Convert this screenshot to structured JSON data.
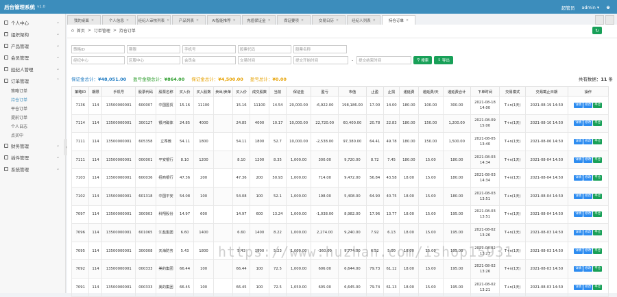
{
  "app": {
    "title": "后台管理系统",
    "version": "v1.0",
    "user_label": "超管员",
    "admin": "admin"
  },
  "sidebar": {
    "items": [
      {
        "label": "个人中心"
      },
      {
        "label": "组织架构"
      },
      {
        "label": "产品管理"
      },
      {
        "label": "会员管理"
      },
      {
        "label": "经纪人管理"
      },
      {
        "label": "订单管理"
      }
    ],
    "sub": [
      "策略订单",
      "持仓订单",
      "平仓订单",
      "提前订单",
      "个人日志",
      "点买中"
    ],
    "bottom": [
      {
        "label": "财务管理"
      },
      {
        "label": "插件管理"
      },
      {
        "label": "系统管理"
      }
    ]
  },
  "tabs": [
    "我的桌面",
    "个人信息",
    "经纪人审核列表",
    "产品列表",
    "AI智能推荐",
    "充值保证金",
    "保证要项",
    "交易日历",
    "经纪人列表",
    "持仓订单"
  ],
  "breadcrumb": {
    "home": "首页",
    "sep": ">",
    "level1": "订单管理",
    "level2": "持仓订单"
  },
  "filters": {
    "row1": [
      "策略ID",
      "期限",
      "手机号",
      "股票代码",
      "股票名称"
    ],
    "row2": [
      "经纪中心",
      "区服中心",
      "会员会",
      "交易时间",
      "提交开始时间",
      "-",
      "提交结束时间"
    ],
    "search_btn": "搜索",
    "export_btn": "导出"
  },
  "stats": {
    "s1_label": "保证金总计：",
    "s1_value": "¥48,051.00",
    "s2_label": "盈亏金额总计：",
    "s2_value": "¥864.00",
    "s3_label": "保证金总计：",
    "s3_value": "¥4,500.00",
    "s4_label": "盈亏总计：",
    "s4_value": "¥0.00",
    "total_label": "共有数据：",
    "total_value": "11",
    "total_unit": "条"
  },
  "table": {
    "headers": [
      "策略ID",
      "期限",
      "手机号",
      "股票代码",
      "股票名称",
      "买入价",
      "买入股数",
      "卖出/卖单",
      "买入价",
      "成交股数",
      "当前",
      "保证金",
      "盈亏",
      "市值",
      "止盈",
      "止损",
      "递延费",
      "递延费/天",
      "递延费合计",
      "下单时间",
      "交易模式",
      "交易截止日期",
      "操作"
    ],
    "rows": [
      [
        "7136",
        "114",
        "13500000001",
        "600007",
        "中国国贸",
        "15.16",
        "11100",
        "",
        "15.16",
        "11100",
        "14.54",
        "20,000.00",
        "-6,922.00",
        "198,186.00",
        "17.00",
        "14.00",
        "180.00",
        "100.00",
        "300.00",
        "2021-08-18 14:00",
        "T+n(1天)",
        "2021-08-19 14:50"
      ],
      [
        "7114",
        "114",
        "13500000001",
        "300127",
        "银河磁体",
        "24.85",
        "4000",
        "",
        "24.85",
        "4000",
        "10.17",
        "10,000.00",
        "22,720.00",
        "60,400.00",
        "20.78",
        "22.83",
        "180.00",
        "150.00",
        "1,200.00",
        "2021-08-09 15:00",
        "T+n(1天)",
        "2021-08-10 14:50"
      ],
      [
        "7111",
        "114",
        "13500000001",
        "605358",
        "立昂微",
        "54.11",
        "1800",
        "",
        "54.11",
        "1800",
        "52.7",
        "10,000.00",
        "-2,538.00",
        "97,380.00",
        "64.41",
        "49.78",
        "180.00",
        "150.00",
        "1,500.00",
        "2021-08-05 13:40",
        "T+n(1天)",
        "2021-08-06 14:50"
      ],
      [
        "7111",
        "114",
        "13500000001",
        "000001",
        "平安银行",
        "8.10",
        "1200",
        "",
        "8.10",
        "1200",
        "8.35",
        "1,000.00",
        "300.00",
        "9,720.00",
        "8.72",
        "7.45",
        "180.00",
        "15.00",
        "180.00",
        "2021-08-03 14:34",
        "T+n(1天)",
        "2021-08-04 14:50"
      ],
      [
        "7103",
        "114",
        "13500000001",
        "600036",
        "招商银行",
        "47.36",
        "200",
        "",
        "47.36",
        "200",
        "50.93",
        "1,000.00",
        "714.00",
        "9,472.00",
        "56.84",
        "43.58",
        "18.00",
        "15.00",
        "180.00",
        "2021-08-03 14:34",
        "T+n(1天)",
        "2021-08-04 14:50"
      ],
      [
        "7102",
        "114",
        "13500000001",
        "601318",
        "中国平安",
        "54.08",
        "100",
        "",
        "54.08",
        "100",
        "52.1",
        "1,000.00",
        "198.00",
        "5,408.00",
        "64.90",
        "40.75",
        "18.00",
        "15.00",
        "180.00",
        "2021-08-03 13:51",
        "T+n(1天)",
        "2021-08-04 14:50"
      ],
      [
        "7097",
        "114",
        "13500000001",
        "300903",
        "科翔股份",
        "14.97",
        "600",
        "",
        "14.97",
        "600",
        "13.24",
        "1,000.00",
        "-1,038.00",
        "8,982.00",
        "17.96",
        "13.77",
        "18.00",
        "15.00",
        "195.00",
        "2021-08-03 13:51",
        "T+n(1天)",
        "2021-08-04 14:50"
      ],
      [
        "7096",
        "114",
        "13500000001",
        "601065",
        "江盐集团",
        "6.60",
        "1400",
        "",
        "6.60",
        "1400",
        "8.22",
        "1,000.00",
        "2,274.00",
        "9,240.00",
        "7.92",
        "6.13",
        "18.00",
        "15.00",
        "195.00",
        "2021-08-02 13:26",
        "T+n(1天)",
        "2021-08-03 14:50"
      ],
      [
        "7095",
        "114",
        "13500000001",
        "300008",
        "天海防务",
        "5.43",
        "1800",
        "",
        "5.43",
        "1800",
        "5.23",
        "1,000.00",
        "-360.00",
        "9,774.00",
        "6.52",
        "5.00",
        "18.00",
        "15.00",
        "195.00",
        "2021-08-02 13:23",
        "T+n(1天)",
        "2021-08-03 14:50"
      ],
      [
        "7092",
        "114",
        "13500000001",
        "000333",
        "美的集团",
        "66.44",
        "100",
        "",
        "66.44",
        "100",
        "72.5",
        "1,000.00",
        "606.00",
        "6,644.00",
        "79.73",
        "61.12",
        "18.00",
        "15.00",
        "195.00",
        "2021-08-02 13:26",
        "T+n(1天)",
        "2021-08-03 14:50"
      ],
      [
        "7091",
        "114",
        "13500000001",
        "000333",
        "美的集团",
        "66.45",
        "100",
        "",
        "66.45",
        "100",
        "72.5",
        "1,050.00",
        "605.00",
        "6,645.00",
        "79.74",
        "61.13",
        "18.00",
        "15.00",
        "195.00",
        "2021-08-02 13:21",
        "T+n(1天)",
        "2021-08-03 14:50"
      ]
    ],
    "ops": [
      "详情",
      "修改",
      "平仓"
    ]
  },
  "watermark": "https://www.huzhan.com/ishop15931"
}
